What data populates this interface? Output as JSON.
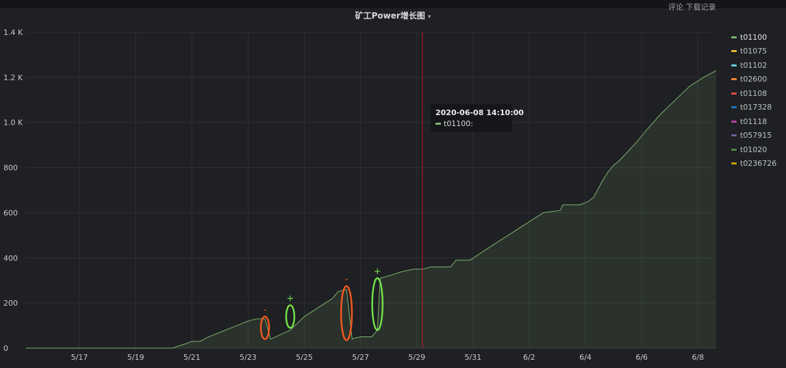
{
  "header": {
    "top_right_text": "评论  下载记录"
  },
  "panel": {
    "title": "矿工Power增长图",
    "menu_caret": "▾"
  },
  "tooltip": {
    "time": "2020-06-08 14:10:00",
    "series": "t01100:",
    "color": "#7eb26d"
  },
  "markers": [
    {
      "x": 23.6,
      "y_low": 40,
      "y_high": 140,
      "sign": "-",
      "color": "#f2571e"
    },
    {
      "x": 24.5,
      "y_low": 90,
      "y_high": 190,
      "sign": "+",
      "color": "#73e049"
    },
    {
      "x": 26.5,
      "y_low": 35,
      "y_high": 275,
      "sign": "-",
      "color": "#f2571e"
    },
    {
      "x": 27.6,
      "y_low": 80,
      "y_high": 310,
      "sign": "+",
      "color": "#73e049"
    }
  ],
  "cursor_x": 29.2,
  "chart_data": {
    "type": "area",
    "title": "矿工Power增长图",
    "xlabel": "",
    "ylabel": "",
    "x_ticks": [
      {
        "x": 17,
        "label": "5/17"
      },
      {
        "x": 19,
        "label": "5/19"
      },
      {
        "x": 21,
        "label": "5/21"
      },
      {
        "x": 23,
        "label": "5/23"
      },
      {
        "x": 25,
        "label": "5/25"
      },
      {
        "x": 27,
        "label": "5/27"
      },
      {
        "x": 29,
        "label": "5/29"
      },
      {
        "x": 31,
        "label": "5/31"
      },
      {
        "x": 33,
        "label": "6/2"
      },
      {
        "x": 35,
        "label": "6/4"
      },
      {
        "x": 37,
        "label": "6/6"
      },
      {
        "x": 39,
        "label": "6/8"
      }
    ],
    "y_ticks": [
      {
        "v": 0,
        "label": "0"
      },
      {
        "v": 200,
        "label": "200"
      },
      {
        "v": 400,
        "label": "400"
      },
      {
        "v": 600,
        "label": "600"
      },
      {
        "v": 800,
        "label": "800"
      },
      {
        "v": 1000,
        "label": "1.0 K"
      },
      {
        "v": 1200,
        "label": "1.2 K"
      },
      {
        "v": 1400,
        "label": "1.4 K"
      }
    ],
    "xlim": [
      15.1,
      39.65
    ],
    "ylim": [
      0,
      1400
    ],
    "grid": true,
    "legend_position": "right",
    "series": [
      {
        "name": "t01100",
        "color": "#7eb26d",
        "points": [
          [
            15.1,
            0
          ],
          [
            20.3,
            0
          ],
          [
            20.8,
            20
          ],
          [
            21.0,
            30
          ],
          [
            21.3,
            30
          ],
          [
            21.5,
            45
          ],
          [
            22.0,
            70
          ],
          [
            22.5,
            95
          ],
          [
            23.0,
            120
          ],
          [
            23.3,
            130
          ],
          [
            23.6,
            130
          ],
          [
            23.8,
            40
          ],
          [
            24.5,
            80
          ],
          [
            25.0,
            140
          ],
          [
            25.5,
            180
          ],
          [
            26.0,
            220
          ],
          [
            26.2,
            250
          ],
          [
            26.5,
            260
          ],
          [
            26.7,
            40
          ],
          [
            26.8,
            45
          ],
          [
            27.0,
            50
          ],
          [
            27.4,
            50
          ],
          [
            27.6,
            80
          ],
          [
            27.7,
            310
          ],
          [
            28.0,
            320
          ],
          [
            28.5,
            340
          ],
          [
            28.9,
            350
          ],
          [
            29.2,
            350
          ],
          [
            29.5,
            360
          ],
          [
            30.2,
            360
          ],
          [
            30.4,
            390
          ],
          [
            30.9,
            390
          ],
          [
            31.5,
            440
          ],
          [
            32.0,
            480
          ],
          [
            32.5,
            520
          ],
          [
            33.0,
            560
          ],
          [
            33.5,
            600
          ],
          [
            34.1,
            610
          ],
          [
            34.2,
            635
          ],
          [
            34.8,
            635
          ],
          [
            35.1,
            650
          ],
          [
            35.3,
            670
          ],
          [
            35.6,
            740
          ],
          [
            35.8,
            780
          ],
          [
            36.0,
            810
          ],
          [
            36.2,
            830
          ],
          [
            36.5,
            870
          ],
          [
            36.8,
            910
          ],
          [
            37.2,
            970
          ],
          [
            37.7,
            1040
          ],
          [
            38.2,
            1100
          ],
          [
            38.7,
            1160
          ],
          [
            39.2,
            1200
          ],
          [
            39.65,
            1230
          ]
        ]
      },
      {
        "name": "t01075",
        "color": "#eab839",
        "points": []
      },
      {
        "name": "t01102",
        "color": "#6ed0e0",
        "points": []
      },
      {
        "name": "t02600",
        "color": "#ef843c",
        "points": []
      },
      {
        "name": "t01108",
        "color": "#e24d42",
        "points": []
      },
      {
        "name": "t017328",
        "color": "#1f78c1",
        "points": []
      },
      {
        "name": "t01118",
        "color": "#ba43a9",
        "points": []
      },
      {
        "name": "t057915",
        "color": "#705da0",
        "points": []
      },
      {
        "name": "t01020",
        "color": "#508642",
        "points": []
      },
      {
        "name": "t0236726",
        "color": "#cca300",
        "points": []
      }
    ]
  }
}
